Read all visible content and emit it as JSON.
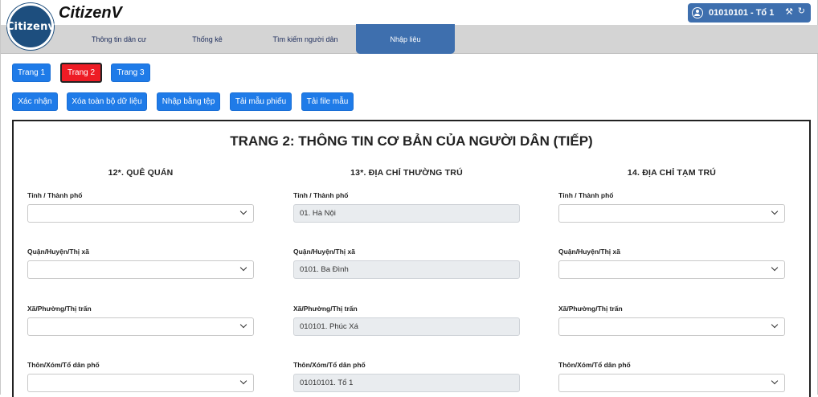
{
  "app": {
    "logo_text": "Citizenv",
    "title": "CitizenV"
  },
  "user": {
    "label": "01010101 - Tổ 1",
    "icons": [
      "user-circle-icon",
      "tools-icon",
      "logout-icon"
    ]
  },
  "nav": {
    "items": [
      {
        "label": "Thông tin dân cư"
      },
      {
        "label": "Thống kê"
      },
      {
        "label": "Tìm kiếm người dân"
      },
      {
        "label": "Nhập liệu",
        "active": true
      }
    ]
  },
  "pages": {
    "items": [
      {
        "label": "Trang 1"
      },
      {
        "label": "Trang 2",
        "active": true
      },
      {
        "label": "Trang 3"
      }
    ]
  },
  "actions": {
    "confirm": "Xác nhận",
    "clear_all": "Xóa toàn bộ dữ liệu",
    "import_file": "Nhập bằng tệp",
    "download_form": "Tải mẫu phiếu",
    "download_file": "Tải file mẫu"
  },
  "form": {
    "heading": "TRANG 2: THÔNG TIN CƠ BẢN CỦA NGƯỜI DÂN (TIẾP)",
    "columns": [
      {
        "title": "12*. QUÊ QUÁN",
        "fields": [
          {
            "label": "Tỉnh / Thành phố",
            "value": ""
          },
          {
            "label": "Quận/Huyện/Thị xã",
            "value": ""
          },
          {
            "label": "Xã/Phường/Thị trấn",
            "value": ""
          },
          {
            "label": "Thôn/Xóm/Tổ dân phố",
            "value": ""
          }
        ]
      },
      {
        "title": "13*. ĐỊA CHỈ THƯỜNG TRÚ",
        "fields": [
          {
            "label": "Tỉnh / Thành phố",
            "value": "01. Hà Nội"
          },
          {
            "label": "Quận/Huyện/Thị xã",
            "value": "0101. Ba Đình"
          },
          {
            "label": "Xã/Phường/Thị trấn",
            "value": "010101. Phúc Xá"
          },
          {
            "label": "Thôn/Xóm/Tổ dân phố",
            "value": "01010101. Tổ 1"
          }
        ]
      },
      {
        "title": "14. ĐỊA CHỈ TẠM TRÚ",
        "fields": [
          {
            "label": "Tỉnh / Thành phố",
            "value": ""
          },
          {
            "label": "Quận/Huyện/Thị xã",
            "value": ""
          },
          {
            "label": "Xã/Phường/Thị trấn",
            "value": ""
          },
          {
            "label": "Thôn/Xóm/Tổ dân phố",
            "value": ""
          }
        ]
      }
    ]
  },
  "colors": {
    "primary": "#1f7be8",
    "active_page": "#ee1c25",
    "header_blue": "#3e6fae",
    "navbar": "#d4d4d4"
  }
}
